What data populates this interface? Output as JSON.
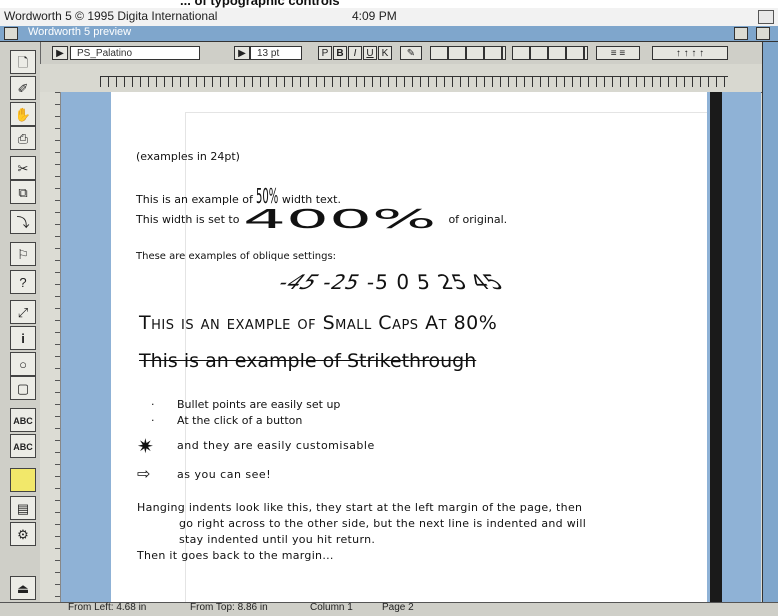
{
  "caption": "... of typographic controls",
  "screen": {
    "app_title": "Wordworth 5  © 1995 Digita International",
    "clock": "4:09 PM"
  },
  "window": {
    "title": "Wordworth 5 preview"
  },
  "ribbon": {
    "style_name": "PS_Palatino",
    "font_size": "13 pt",
    "style_buttons": [
      "P",
      "B",
      "I",
      "U",
      "K"
    ]
  },
  "toolbar": {
    "icons": [
      "new-document-icon",
      "open-icon",
      "save-icon",
      "print-icon",
      "cut-icon",
      "copy-icon",
      "paste-icon",
      "find-icon",
      "help-icon",
      "zoom-icon",
      "info-icon",
      "search-icon",
      "frame-icon",
      "spellcheck-icon",
      "thesaurus-icon",
      "note-icon",
      "gallery-icon",
      "preferences-icon",
      "quit-icon"
    ]
  },
  "document": {
    "examples_note": "(examples in 24pt)",
    "width50_before": "This is an example of",
    "width50_value": "50%",
    "width50_after": "width text.",
    "width400_before": "This width is set to",
    "width400_value": "400%",
    "width400_after": "of original.",
    "oblique_label": "These are examples of oblique settings:",
    "oblique_values": [
      "-45",
      "-25",
      "-5",
      "0",
      "5",
      "25",
      "45"
    ],
    "small_caps": "This is an example of Small Caps At 80%",
    "strikethrough": "This is an example of Strikethrough",
    "bullet_1": "Bullet points are easily set up",
    "bullet_2": "At the click of a button",
    "bullet_3": "and they are easily customisable",
    "bullet_4": "as you can see!",
    "hanging_1": "Hanging indents look like this, they start at the left margin of the page, then",
    "hanging_2": "go right across to the other side, but the next line is indented and will",
    "hanging_3": "stay indented until you hit return.",
    "hanging_4": "Then it goes back to the margin..."
  },
  "status": {
    "from_left": "From Left: 4.68 in",
    "from_top": "From Top: 8.86 in",
    "column": "Column 1",
    "page": "Page 2"
  }
}
